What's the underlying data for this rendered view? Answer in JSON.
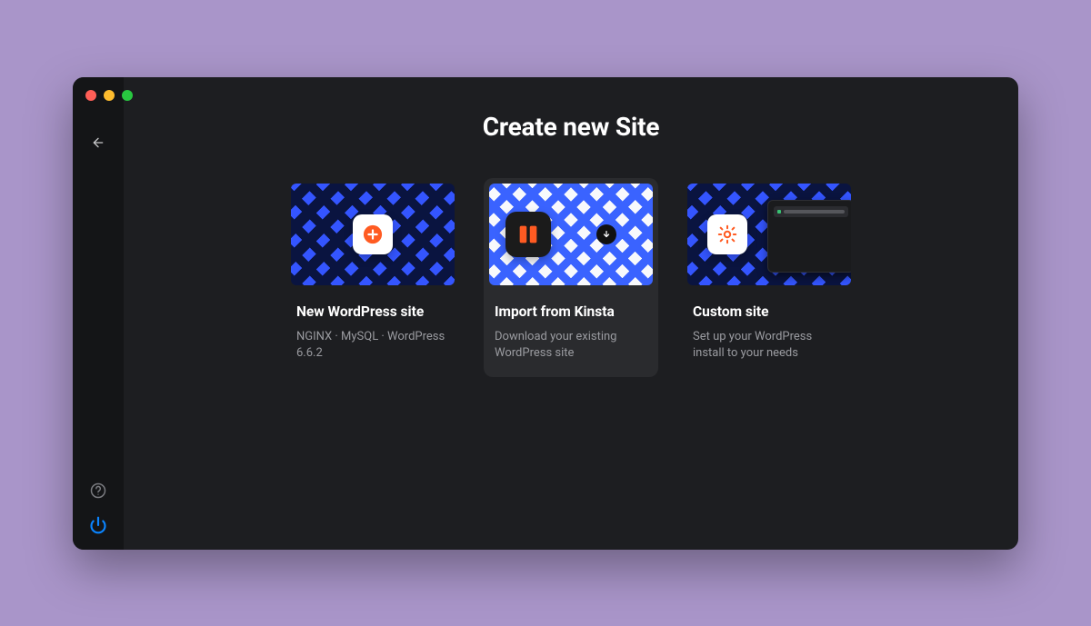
{
  "page": {
    "title": "Create new Site"
  },
  "cards": [
    {
      "title": "New WordPress site",
      "desc": "NGINX · MySQL · WordPress 6.6.2",
      "icon": "plus",
      "variant": "dark"
    },
    {
      "title": "Import from Kinsta",
      "desc": "Download your existing WordPress site",
      "icon": "kinsta",
      "variant": "light",
      "hover": true
    },
    {
      "title": "Custom site",
      "desc": "Set up your WordPress install to your needs",
      "icon": "gear",
      "variant": "dark",
      "browser_overlay": true
    }
  ],
  "rail": {
    "back": "←",
    "help": "?",
    "power": "⏻"
  }
}
